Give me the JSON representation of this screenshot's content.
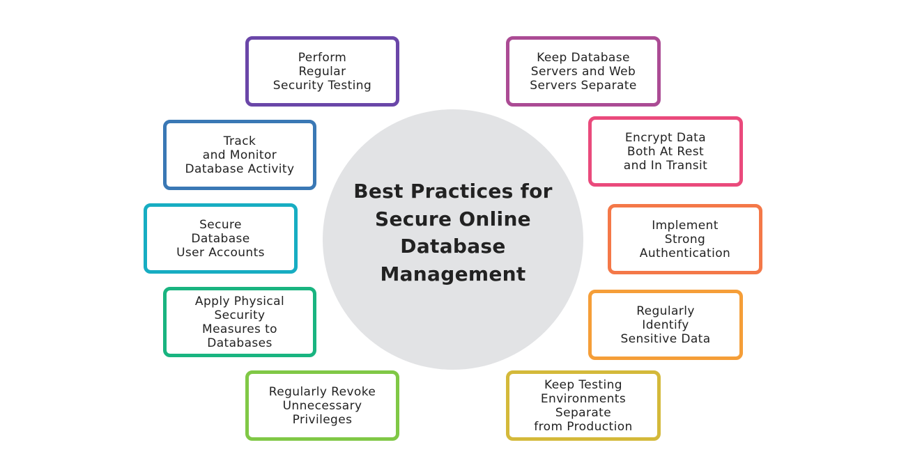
{
  "title": "Best Practices for\nSecure Online\nDatabase\nManagement",
  "practices": [
    {
      "label": "Perform\nRegular\nSecurity Testing",
      "color": "#6a46a8"
    },
    {
      "label": "Track\nand Monitor\nDatabase Activity",
      "color": "#3a78b5"
    },
    {
      "label": "Secure\nDatabase\nUser Accounts",
      "color": "#17adc2"
    },
    {
      "label": "Apply Physical\nSecurity\nMeasures to\nDatabases",
      "color": "#19b480"
    },
    {
      "label": "Regularly Revoke\nUnnecessary\nPrivileges",
      "color": "#80c846"
    },
    {
      "label": "Keep Database\nServers and Web\nServers Separate",
      "color": "#ab4b94"
    },
    {
      "label": "Encrypt Data\nBoth At Rest\nand In Transit",
      "color": "#ea4a7c"
    },
    {
      "label": "Implement\nStrong\nAuthentication",
      "color": "#f47848"
    },
    {
      "label": "Regularly\nIdentify\nSensitive Data",
      "color": "#f59e38"
    },
    {
      "label": "Keep Testing\nEnvironments\nSeparate\nfrom Production",
      "color": "#d4b93a"
    }
  ],
  "hub_color": "#e2e3e5"
}
